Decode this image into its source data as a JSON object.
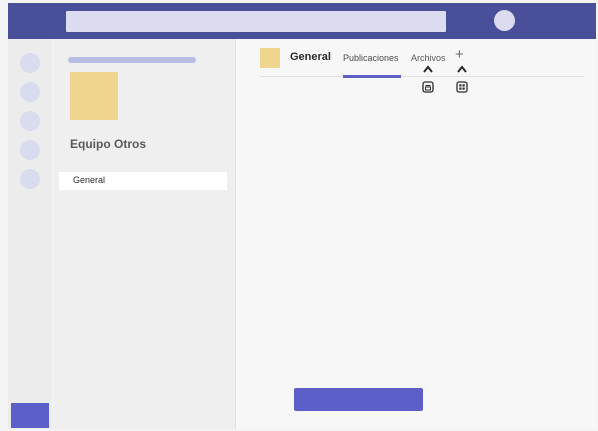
{
  "team": {
    "name": "Equipo Otros",
    "channels": [
      {
        "label": "General",
        "selected": true
      }
    ]
  },
  "channel": {
    "title": "General",
    "tabs": [
      {
        "label": "Publicaciones",
        "active": true
      },
      {
        "label": "Archivos",
        "active": false
      }
    ],
    "add_tab_glyph": "+"
  },
  "icons": {
    "rail": [
      "app-icon",
      "app-icon",
      "app-icon",
      "app-icon",
      "app-icon"
    ],
    "tab_hints": [
      "caret-up-icon",
      "caret-up-icon"
    ],
    "tab_hint_icons": [
      "file-tab-icon",
      "apps-grid-icon"
    ]
  },
  "colors": {
    "topbar": "#4a4f9a",
    "accent": "#5b5fc7",
    "team_avatar": "#efd58e",
    "placeholder": "#dcdcf0"
  }
}
